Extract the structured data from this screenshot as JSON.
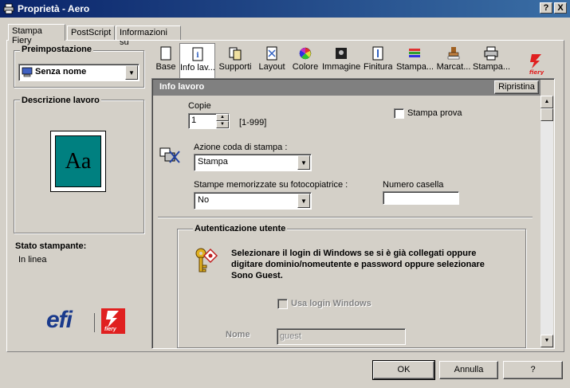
{
  "window": {
    "title": "Proprietà - Aero",
    "help_btn": "?",
    "close_btn": "X"
  },
  "tabs": [
    "Stampa Fiery",
    "PostScript",
    "Informazioni su"
  ],
  "left": {
    "preset_label": "Preimpostazione",
    "preset_value": "Senza nome",
    "desc_label": "Descrizione lavoro",
    "preview_text": "Aa",
    "status_label": "Stato stampante:",
    "status_value": "In linea",
    "logo_efi": "efi",
    "logo_fiery": "fiery"
  },
  "toolbar": {
    "items": [
      "Base",
      "Info lav...",
      "Supporti",
      "Layout",
      "Colore",
      "Immagine",
      "Finitura",
      "Stampa...",
      "Marcat...",
      "Stampa..."
    ],
    "brand": "fiery"
  },
  "section": {
    "title": "Info lavoro",
    "reset_btn": "Ripristina"
  },
  "form": {
    "copies_label": "Copie",
    "copies_value": "1",
    "copies_range": "[1-999]",
    "proof_label": "Stampa prova",
    "queue_label": "Azione coda di stampa :",
    "queue_value": "Stampa",
    "stored_label": "Stampe memorizzate su fotocopiatrice :",
    "stored_value": "No",
    "mailbox_label": "Numero casella",
    "mailbox_value": ""
  },
  "auth": {
    "title": "Autenticazione utente",
    "message": "Selezionare il login di Windows se si è già collegati oppure digitare dominio/nomeutente e password oppure selezionare Sono Guest.",
    "windows_login_label": "Usa login Windows",
    "name_label": "Nome",
    "name_value": "guest"
  },
  "buttons": {
    "ok": "OK",
    "cancel": "Annulla",
    "help": "?"
  }
}
